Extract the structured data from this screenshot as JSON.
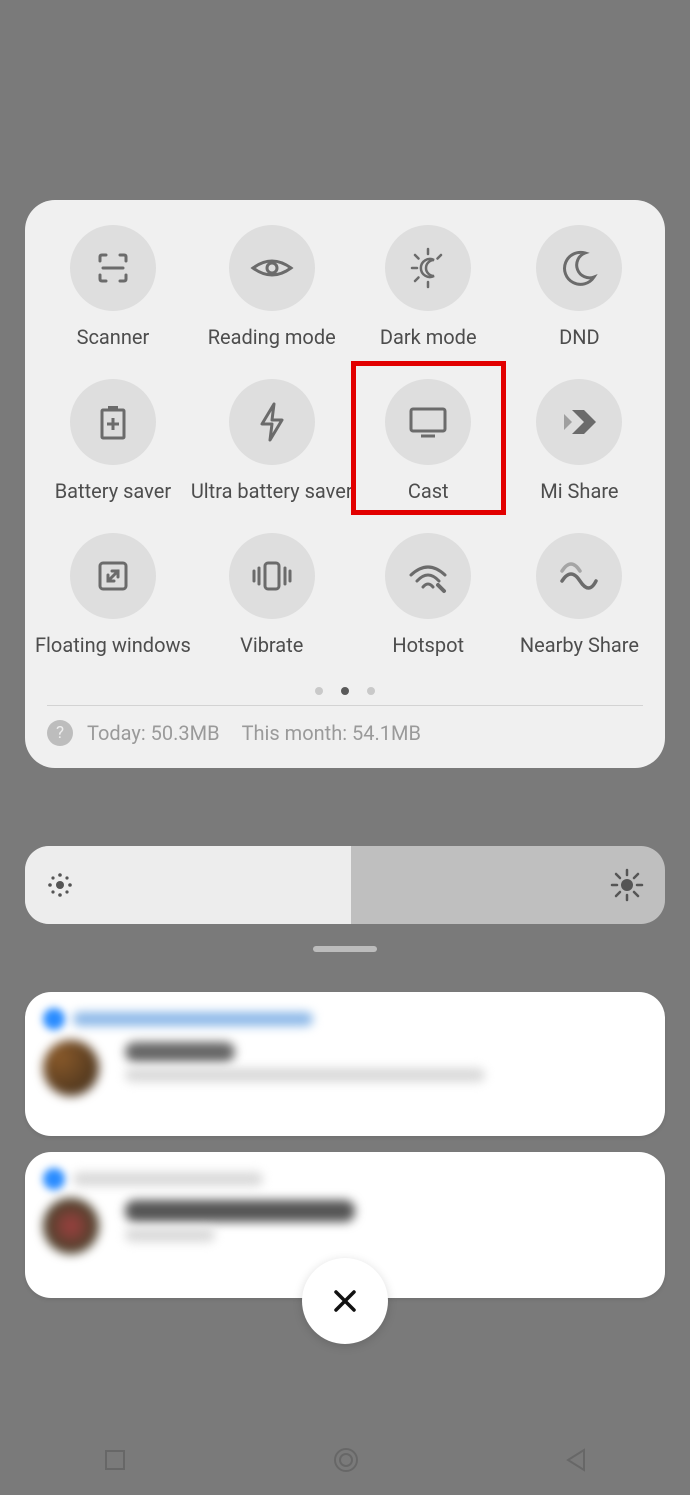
{
  "tiles": [
    {
      "id": "scanner",
      "label": "Scanner",
      "icon": "scanner-icon"
    },
    {
      "id": "reading-mode",
      "label": "Reading mode",
      "icon": "eye-icon"
    },
    {
      "id": "dark-mode",
      "label": "Dark mode",
      "icon": "dark-mode-icon"
    },
    {
      "id": "dnd",
      "label": "DND",
      "icon": "moon-icon"
    },
    {
      "id": "battery-saver",
      "label": "Battery saver",
      "icon": "battery-plus-icon"
    },
    {
      "id": "ultra-battery-saver",
      "label": "Ultra battery saver",
      "icon": "bolt-icon"
    },
    {
      "id": "cast",
      "label": "Cast",
      "icon": "cast-icon",
      "highlighted": true
    },
    {
      "id": "mi-share",
      "label": "Mi Share",
      "icon": "mi-share-icon"
    },
    {
      "id": "floating-windows",
      "label": "Floating windows",
      "icon": "floating-window-icon"
    },
    {
      "id": "vibrate",
      "label": "Vibrate",
      "icon": "vibrate-icon"
    },
    {
      "id": "hotspot",
      "label": "Hotspot",
      "icon": "hotspot-icon"
    },
    {
      "id": "nearby-share",
      "label": "Nearby Share",
      "icon": "nearby-share-icon"
    }
  ],
  "pagination": {
    "count": 3,
    "active_index": 1
  },
  "data_usage": {
    "help": "?",
    "today_label": "Today: 50.3MB",
    "month_label": "This month: 54.1MB"
  },
  "brightness": {
    "percent": 51
  },
  "close_label": "✕",
  "colors": {
    "highlight": "#e20000",
    "panel_bg": "#f0f0f0",
    "circle_bg": "#dedede"
  }
}
